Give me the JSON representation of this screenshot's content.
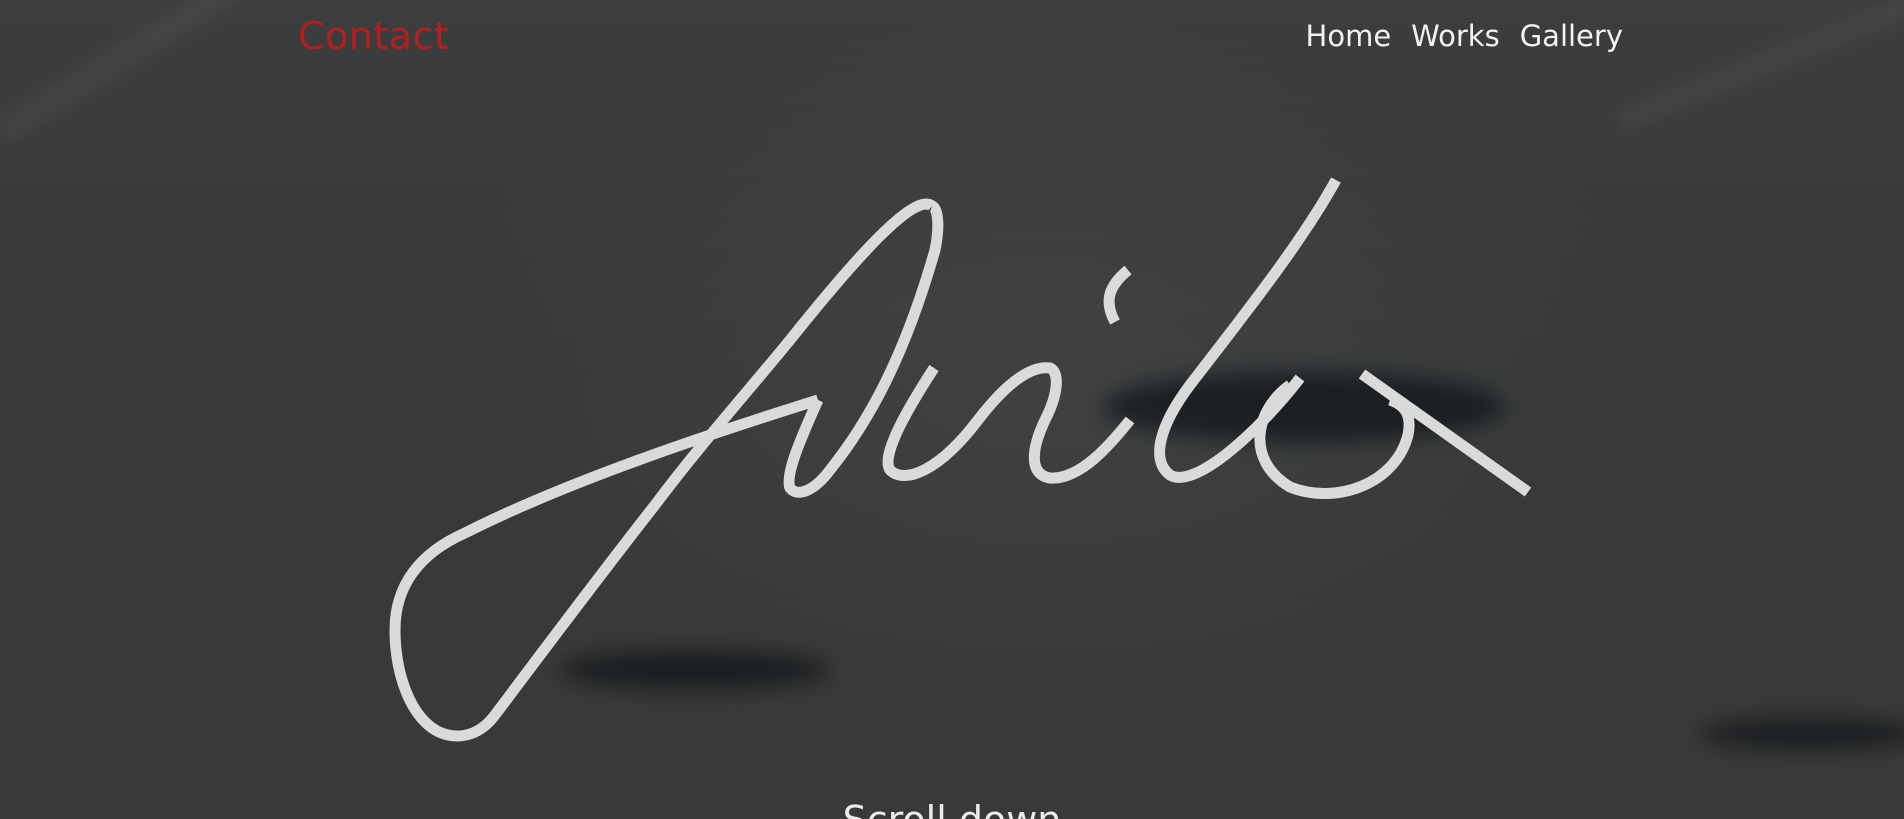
{
  "header": {
    "contact_label": "Contact",
    "nav": {
      "home": "Home",
      "works": "Works",
      "gallery": "Gallery"
    }
  },
  "hero": {
    "signature_text": "Aviko",
    "subtitle": "Scroll down"
  },
  "colors": {
    "accent": "#b51f1f",
    "nav_text": "#f2f2f2",
    "signature_stroke": "#dadada",
    "background": "#3a3c3d"
  }
}
